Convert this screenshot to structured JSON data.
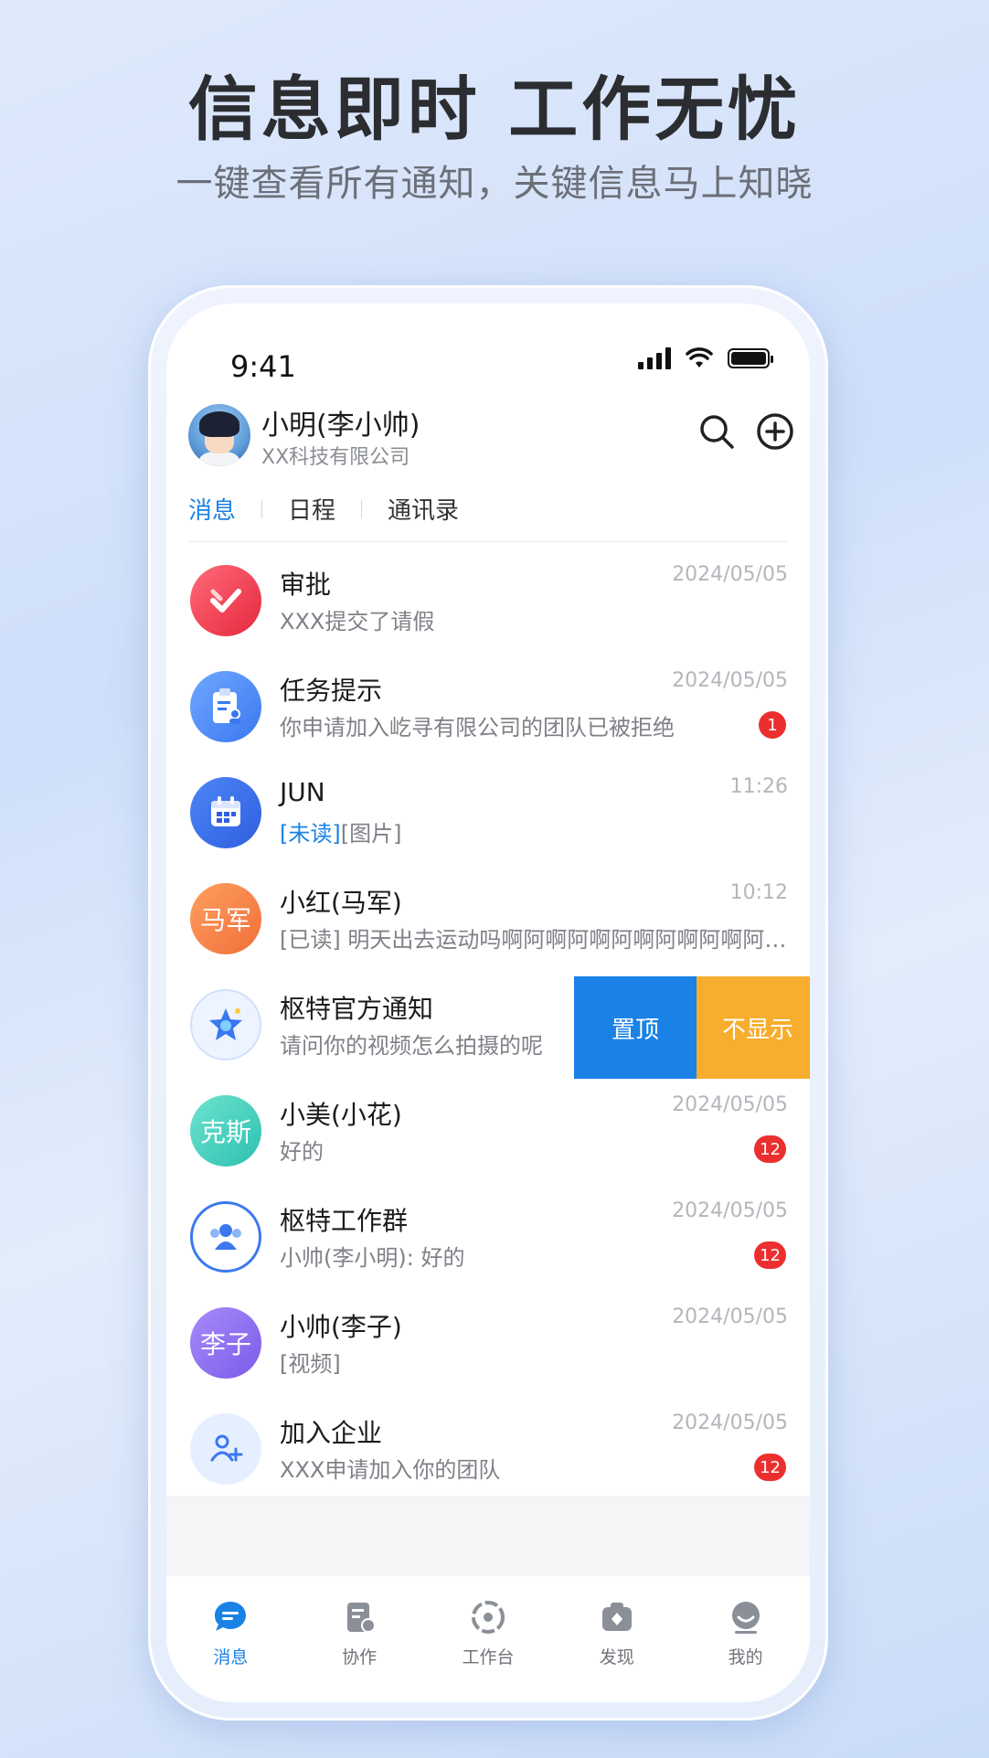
{
  "promo": {
    "headline": "信息即时 工作无忧",
    "subline": "一键查看所有通知，关键信息马上知晓"
  },
  "status_bar": {
    "time": "9:41"
  },
  "header": {
    "user_name": "小明(李小帅)",
    "company": "XX科技有限公司"
  },
  "tabs": [
    "消息",
    "日程",
    "通讯录"
  ],
  "messages": [
    {
      "title": "审批",
      "preview": "XXX提交了请假",
      "time": "2024/05/05",
      "badge": ""
    },
    {
      "title": "任务提示",
      "preview": "你申请加入屹寻有限公司的团队已被拒绝",
      "time": "2024/05/05",
      "badge": "1"
    },
    {
      "title": "JUN",
      "preview_tag": "[未读]",
      "preview": "[图片]",
      "time": "11:26",
      "badge": ""
    },
    {
      "title": "小红(马军)",
      "avatar_text": "马军",
      "preview": "[已读] 明天出去运动吗啊阿啊阿啊阿啊阿啊阿啊阿啊阿啊",
      "time": "10:12",
      "badge": ""
    },
    {
      "title": "枢特官方通知",
      "preview": "请问你的视频怎么拍摄的呢",
      "time": "",
      "badge": ""
    },
    {
      "title": "小美(小花)",
      "avatar_text": "克斯",
      "preview": "好的",
      "time": "2024/05/05",
      "badge": "12"
    },
    {
      "title": "枢特工作群",
      "preview": "小帅(李小明): 好的",
      "time": "2024/05/05",
      "badge": "12"
    },
    {
      "title": "小帅(李子)",
      "avatar_text": "李子",
      "preview": "[视频]",
      "time": "2024/05/05",
      "badge": ""
    },
    {
      "title": "加入企业",
      "preview": "XXX申请加入你的团队",
      "time": "2024/05/05",
      "badge": "12"
    }
  ],
  "swipe_actions": {
    "pin": "置顶",
    "hide": "不显示"
  },
  "tabbar": [
    "消息",
    "协作",
    "工作台",
    "发现",
    "我的"
  ],
  "colors": {
    "accent": "#1a82e6",
    "badge": "#eb2f2f",
    "hide_action": "#f7ad2e"
  }
}
